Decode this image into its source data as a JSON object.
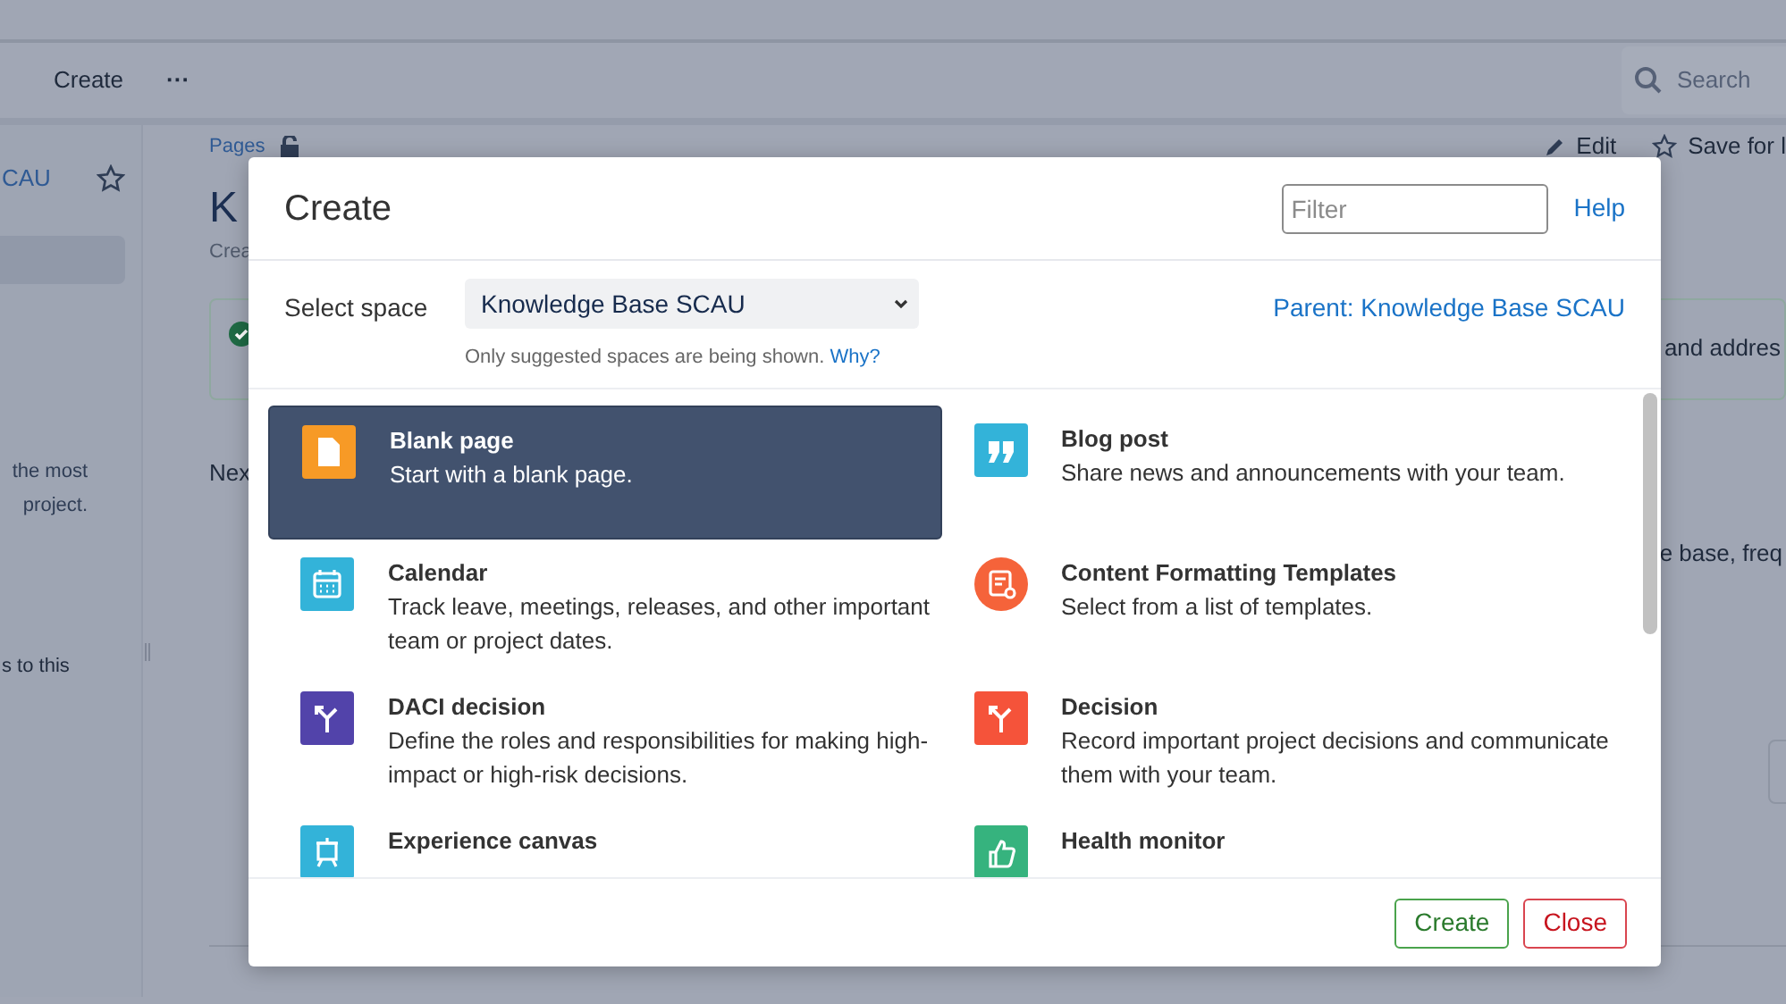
{
  "topbar": {
    "items": [
      {
        "label": "Create"
      },
      {
        "label": "···"
      }
    ],
    "search": {
      "placeholder": "Search"
    }
  },
  "sidebar": {
    "space_link": "CAU",
    "texts": [
      "the most",
      "project.",
      "s to this"
    ]
  },
  "page": {
    "breadcrumb": "Pages",
    "title": "K",
    "byline": "Crea",
    "actions": [
      {
        "kind": "edit",
        "label": "Edit"
      },
      {
        "kind": "save",
        "label": "Save for l"
      }
    ],
    "notice": "and addres",
    "section_heading": "Nex",
    "text": "e base, freq"
  },
  "dialog": {
    "title": "Create",
    "filter": {
      "placeholder": "Filter"
    },
    "help": "Help",
    "space_label": "Select space",
    "space_value": "Knowledge Base SCAU",
    "hint": "Only suggested spaces are being shown.",
    "hint_link": "Why?",
    "parent_link": "Parent: Knowledge Base SCAU",
    "templates": [
      {
        "kind": "blank",
        "title": "Blank page",
        "description": "Start with a blank page.",
        "color": "#f79a26",
        "selected": true
      },
      {
        "kind": "quote",
        "title": "Blog post",
        "description": "Share news and announcements with your team.",
        "color": "#33b3d9",
        "selected": false
      },
      {
        "kind": "calendar",
        "title": "Calendar",
        "description": "Track leave, meetings, releases, and other important team or project dates.",
        "color": "#33b3d9",
        "selected": false
      },
      {
        "kind": "formatting",
        "title": "Content Formatting Templates",
        "description": "Select from a list of templates.",
        "color": "#f5633a",
        "selected": false
      },
      {
        "kind": "fork",
        "title": "DACI decision",
        "description": "Define the roles and responsibilities for making high-impact or high-risk decisions.",
        "color": "#5243aa",
        "selected": false
      },
      {
        "kind": "fork",
        "title": "Decision",
        "description": "Record important project decisions and communicate them with your team.",
        "color": "#f5533a",
        "selected": false
      },
      {
        "kind": "easel",
        "title": "Experience canvas",
        "color": "#33b3d9",
        "selected": false
      },
      {
        "kind": "thumb",
        "title": "Health monitor",
        "color": "#36b37e",
        "selected": false
      }
    ],
    "buttons": [
      {
        "kind": "primary",
        "label": "Create"
      },
      {
        "kind": "close",
        "label": "Close"
      }
    ]
  }
}
